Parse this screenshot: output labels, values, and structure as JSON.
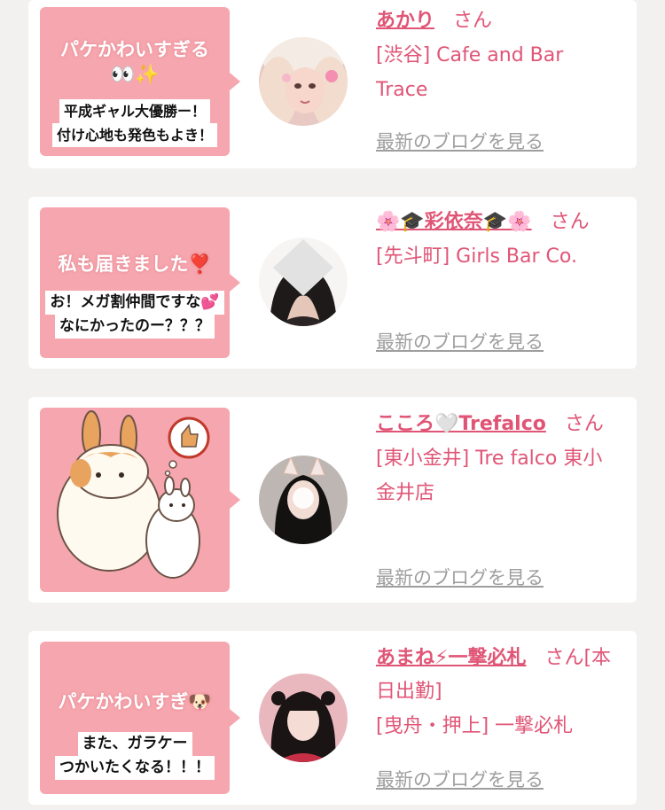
{
  "cards": [
    {
      "stamp_title": "パケかわいすぎる",
      "stamp_emoji": "👀✨",
      "stamp_lines": [
        "平成ギャル大優勝ー！",
        "付け心地も発色もよき！"
      ],
      "name": "あかり",
      "honorific": "さん",
      "shop": "[渋谷] Cafe and Bar Trace",
      "blog_link": "最新のブログを見る"
    },
    {
      "stamp_title": "私も届きました❣️",
      "stamp_lines": [
        "お！メガ割仲間ですな💕",
        "なにかったのー？？？"
      ],
      "name": "🌸🎓彩依奈🎓🌸",
      "honorific": "さん",
      "shop": "[先斗町] Girls Bar Co.",
      "blog_link": "最新のブログを見る"
    },
    {
      "name": "こころ🤍Trefalco",
      "honorific": "さん",
      "shop": "[東小金井] Tre falco 東小金井店",
      "blog_link": "最新のブログを見る"
    },
    {
      "stamp_title": "パケかわいすぎ🐶",
      "stamp_lines": [
        "また、ガラケー",
        "つかいたくなる！！！"
      ],
      "name": "あまね⚡一撃必札",
      "honorific": "さん",
      "status": "[本日出勤]",
      "shop": "[曳舟・押上] 一撃必札",
      "blog_link": "最新のブログを見る"
    }
  ]
}
